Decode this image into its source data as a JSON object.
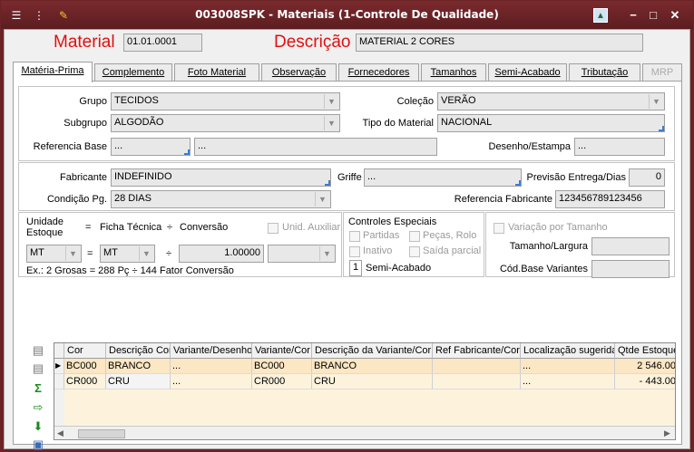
{
  "window": {
    "title": "003008SPK - Materiais (1-Controle De Qualidade)"
  },
  "header": {
    "material_label": "Material",
    "material_value": "01.01.0001",
    "descricao_label": "Descrição",
    "descricao_value": "MATERIAL 2 CORES"
  },
  "tabs": [
    {
      "label": "Matéria-Prima",
      "active": true
    },
    {
      "label": "Complemento"
    },
    {
      "label": "Foto Material"
    },
    {
      "label": "Observação"
    },
    {
      "label": "Fornecedores"
    },
    {
      "label": "Tamanhos"
    },
    {
      "label": "Semi-Acabado"
    },
    {
      "label": "Tributação"
    },
    {
      "label": "MRP",
      "disabled": true
    }
  ],
  "section1": {
    "grupo_label": "Grupo",
    "grupo_value": "TECIDOS",
    "subgrupo_label": "Subgrupo",
    "subgrupo_value": "ALGODÃO",
    "refbase_label": "Referencia Base",
    "refbase_code": "...",
    "refbase_desc": "...",
    "colecao_label": "Coleção",
    "colecao_value": "VERÃO",
    "tipo_label": "Tipo do Material",
    "tipo_value": "NACIONAL",
    "desenho_label": "Desenho/Estampa",
    "desenho_value": "..."
  },
  "section2": {
    "fabricante_label": "Fabricante",
    "fabricante_value": "INDEFINIDO",
    "condicao_label": "Condição Pg.",
    "condicao_value": "28 DIAS",
    "griffe_label": "Griffe",
    "griffe_value": "...",
    "previsao_label": "Previsão Entrega/Dias",
    "previsao_value": "0",
    "reffab_label": "Referencia Fabricante",
    "reffab_value": "123456789123456"
  },
  "units": {
    "unidade_label": "Unidade",
    "estoque_label": "Estoque",
    "eq": "=",
    "ficha_label": "Ficha Técnica",
    "div": "÷",
    "conversao_label": "Conversão",
    "auxiliar_label": "Unid. Auxiliar",
    "estoque_value": "MT",
    "ficha_value": "MT",
    "conversao_value": "1.00000",
    "example": "Ex.: 2 Grosas = 288 Pç  ÷  144 Fator Conversão"
  },
  "controles": {
    "title": "Controles Especiais",
    "partidas": "Partidas",
    "pecas": "Peças, Rolo",
    "inativo": "Inativo",
    "saida": "Saída parcial",
    "semi_num": "1",
    "semi_label": "Semi-Acabado"
  },
  "variacao": {
    "label": "Variação por Tamanho",
    "tamanho_label": "Tamanho/Largura",
    "codbase_label": "Cód.Base Variantes"
  },
  "grid": {
    "columns": [
      "Cor",
      "Descrição Cor",
      "Variante/Desenho",
      "Variante/Cor",
      "Descrição da Variante/Cor",
      "Ref Fabricante/Cor",
      "Localização sugerida",
      "Qtde Estoque"
    ],
    "rows": [
      [
        "BC000",
        "BRANCO",
        "...",
        "BC000",
        "BRANCO",
        "",
        "...",
        "2 546.00"
      ],
      [
        "CR000",
        "CRU",
        "...",
        "CR000",
        "CRU",
        "",
        "...",
        "- 443.00"
      ]
    ]
  },
  "colors": {
    "title_bg": "#6b2326",
    "accent_red": "#e01010",
    "row_selected": "#fbe7c4",
    "row_normal": "#fdf3dc"
  }
}
